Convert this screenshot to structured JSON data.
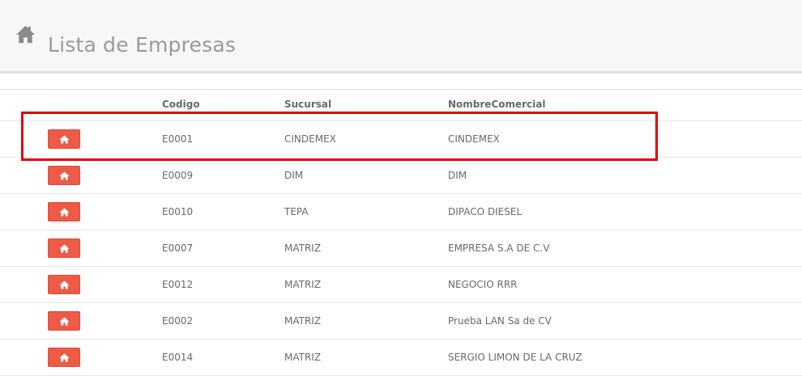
{
  "header": {
    "title": "Lista de Empresas",
    "icon": "home-icon"
  },
  "table": {
    "columns": [
      "",
      "Codigo",
      "Sucursal",
      "NombreComercial"
    ],
    "rows": [
      {
        "codigo": "E0001",
        "sucursal": "CINDEMEX",
        "nombre": "CINDEMEX",
        "highlighted": true
      },
      {
        "codigo": "E0009",
        "sucursal": "DIM",
        "nombre": "DIM"
      },
      {
        "codigo": "E0010",
        "sucursal": "TEPA",
        "nombre": "DIPACO DIESEL"
      },
      {
        "codigo": "E0007",
        "sucursal": "MATRIZ",
        "nombre": "EMPRESA S.A DE C.V"
      },
      {
        "codigo": "E0012",
        "sucursal": "MATRIZ",
        "nombre": "NEGOCIO RRR"
      },
      {
        "codigo": "E0002",
        "sucursal": "MATRIZ",
        "nombre": "Prueba LAN Sa de CV"
      },
      {
        "codigo": "E0014",
        "sucursal": "MATRIZ",
        "nombre": "SERGIO LIMON DE LA CRUZ"
      }
    ],
    "row_button_icon": "home-icon"
  },
  "colors": {
    "button": "#ed5a45",
    "highlight": "#e20000",
    "header_bg": "#f7f7f7"
  }
}
